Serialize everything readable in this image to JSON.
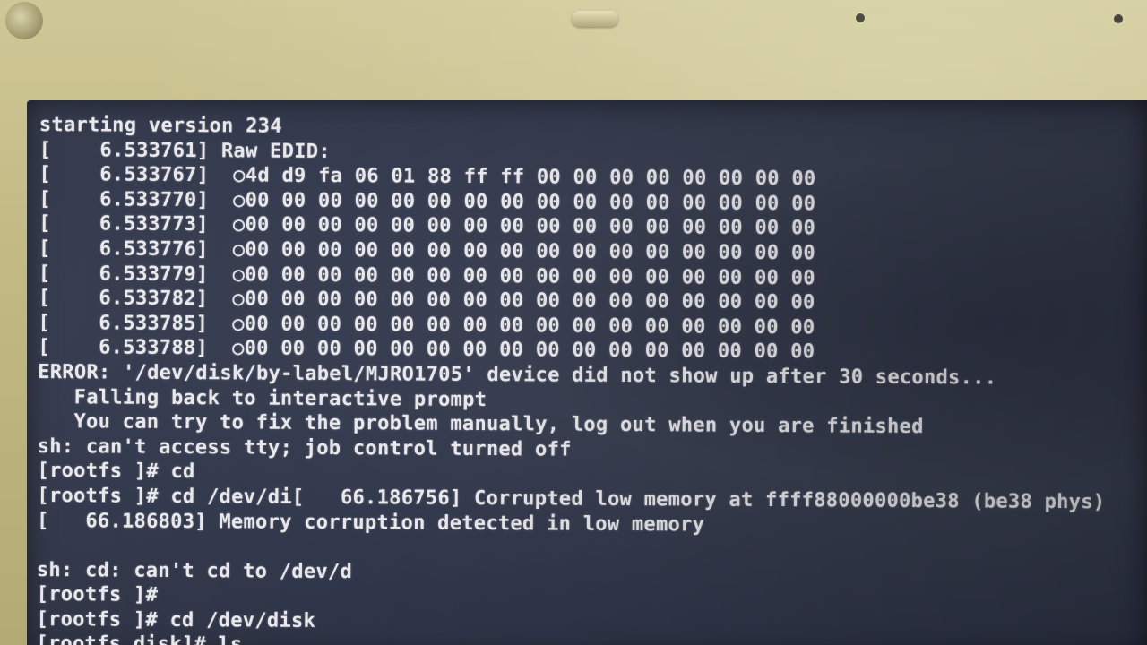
{
  "terminal": {
    "lines": [
      "starting version 234",
      "[    6.533761] Raw EDID:",
      "[    6.533767]  ○4d d9 fa 06 01 88 ff ff 00 00 00 00 00 00 00 00",
      "[    6.533770]  ○00 00 00 00 00 00 00 00 00 00 00 00 00 00 00 00",
      "[    6.533773]  ○00 00 00 00 00 00 00 00 00 00 00 00 00 00 00 00",
      "[    6.533776]  ○00 00 00 00 00 00 00 00 00 00 00 00 00 00 00 00",
      "[    6.533779]  ○00 00 00 00 00 00 00 00 00 00 00 00 00 00 00 00",
      "[    6.533782]  ○00 00 00 00 00 00 00 00 00 00 00 00 00 00 00 00",
      "[    6.533785]  ○00 00 00 00 00 00 00 00 00 00 00 00 00 00 00 00",
      "[    6.533788]  ○00 00 00 00 00 00 00 00 00 00 00 00 00 00 00 00",
      "ERROR: '/dev/disk/by-label/MJRO1705' device did not show up after 30 seconds...",
      "   Falling back to interactive prompt",
      "   You can try to fix the problem manually, log out when you are finished",
      "sh: can't access tty; job control turned off",
      "[rootfs ]# cd",
      "[rootfs ]# cd /dev/di[   66.186756] Corrupted low memory at ffff88000000be38 (be38 phys)",
      "[   66.186803] Memory corruption detected in low memory",
      "",
      "sh: cd: can't cd to /dev/d",
      "[rootfs ]#",
      "[rootfs ]# cd /dev/disk",
      "[rootfs disk]# ls"
    ]
  }
}
